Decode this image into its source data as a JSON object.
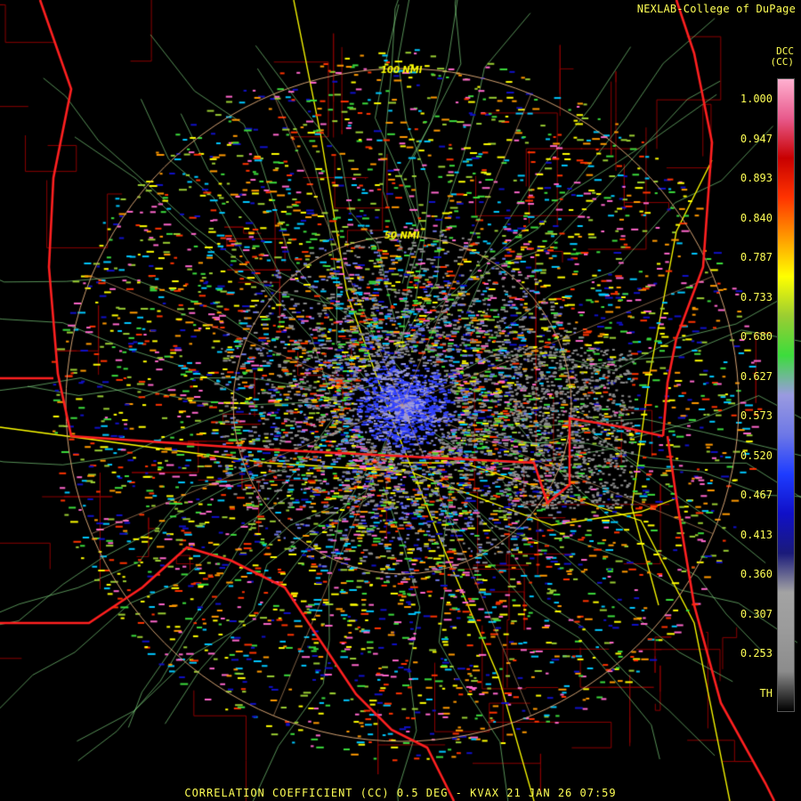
{
  "credit": "NEXLAB-College of DuPage",
  "product_code": "DCC",
  "product_unit": "(CC)",
  "footer": "CORRELATION COEFFICIENT (CC) 0.5 DEG - KVAX 21 JAN 26 07:59",
  "range_rings": [
    "100 NMI",
    "50 NMI"
  ],
  "legend": {
    "labels": [
      "1.000",
      "0.947",
      "0.893",
      "0.840",
      "0.787",
      "0.733",
      "0.680",
      "0.627",
      "0.573",
      "0.520",
      "0.467",
      "0.413",
      "0.360",
      "0.307",
      "0.253",
      "TH"
    ],
    "colors": [
      "#000000",
      "#8c8c8c",
      "#9a9a9a",
      "#a3a3a3",
      "#1a1a7a",
      "#1010c8",
      "#1e3cff",
      "#6e78e6",
      "#9a9ae0",
      "#3cdc3c",
      "#9acd32",
      "#ffff00",
      "#ff9900",
      "#ff3300",
      "#c80000",
      "#e85a8c",
      "#ffb0d0"
    ]
  },
  "colors": {
    "state_border": "#ff2020",
    "county_border": "#8b0000",
    "highway": "#ffff00",
    "road": "#90ee90",
    "range_ring": "#d2a070"
  }
}
